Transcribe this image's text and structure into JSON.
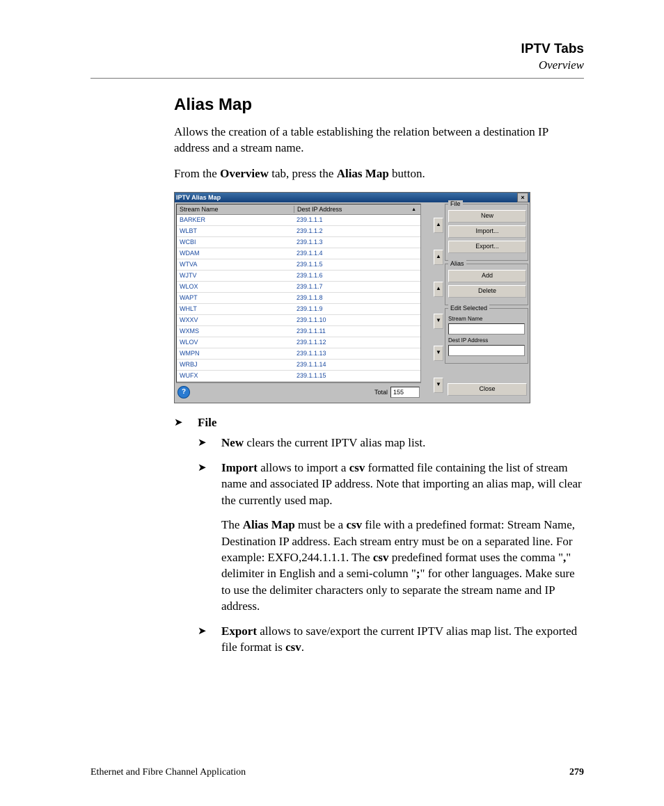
{
  "header": {
    "title": "IPTV Tabs",
    "subtitle": "Overview"
  },
  "section_title": "Alias Map",
  "intro1": "Allows the creation of a table establishing the relation between a destination IP address and a stream name.",
  "intro2_a": "From the ",
  "intro2_b": "Overview",
  "intro2_c": " tab, press the ",
  "intro2_d": "Alias Map",
  "intro2_e": " button.",
  "dialog": {
    "title": "IPTV Alias Map",
    "close_x": "×",
    "columns": {
      "stream": "Stream Name",
      "dest": "Dest IP Address"
    },
    "rows": [
      {
        "name": "BARKER",
        "ip": "239.1.1.1"
      },
      {
        "name": "WLBT",
        "ip": "239.1.1.2"
      },
      {
        "name": "WCBI",
        "ip": "239.1.1.3"
      },
      {
        "name": "WDAM",
        "ip": "239.1.1.4"
      },
      {
        "name": "WTVA",
        "ip": "239.1.1.5"
      },
      {
        "name": "WJTV",
        "ip": "239.1.1.6"
      },
      {
        "name": "WLOX",
        "ip": "239.1.1.7"
      },
      {
        "name": "WAPT",
        "ip": "239.1.1.8"
      },
      {
        "name": "WHLT",
        "ip": "239.1.1.9"
      },
      {
        "name": "WXXV",
        "ip": "239.1.1.10"
      },
      {
        "name": "WXMS",
        "ip": "239.1.1.11"
      },
      {
        "name": "WLOV",
        "ip": "239.1.1.12"
      },
      {
        "name": "WMPN",
        "ip": "239.1.1.13"
      },
      {
        "name": "WRBJ",
        "ip": "239.1.1.14"
      },
      {
        "name": "WUFX",
        "ip": "239.1.1.15"
      }
    ],
    "total_label": "Total",
    "total_value": "155",
    "help": "?",
    "groups": {
      "file": {
        "title": "File",
        "new": "New",
        "import": "Import...",
        "export": "Export..."
      },
      "alias": {
        "title": "Alias",
        "add": "Add",
        "delete": "Delete"
      },
      "edit": {
        "title": "Edit Selected",
        "stream_label": "Stream Name",
        "dest_label": "Dest IP Address"
      }
    },
    "close": "Close",
    "arrows": {
      "top": "▲",
      "up": "▲",
      "mid_up": "▲",
      "mid_dn": "▼",
      "dn": "▼",
      "bot": "▼"
    }
  },
  "list": {
    "file_label": "File",
    "new_label": "New",
    "new_text": " clears the current IPTV alias map list.",
    "import_label": "Import",
    "import_text_a": " allows to import a ",
    "csv": "csv",
    "import_text_b": " formatted file containing the list of stream name and associated IP address. Note that importing an alias map, will clear the currently used map.",
    "import_para2_a": "The ",
    "import_para2_b": "Alias Map",
    "import_para2_c": " must be a ",
    "import_para2_d": " file with a predefined format: Stream Name, Destination IP address. Each stream entry must be on a separated line. For example: EXFO,244.1.1.1. The ",
    "import_para2_e": " predefined format uses the comma \"",
    "comma": ",",
    "import_para2_f": "\" delimiter in English and a semi-column \"",
    "semi": ";",
    "import_para2_g": "\" for other languages. Make sure to use the delimiter characters only to separate the stream name and IP address.",
    "export_label": "Export",
    "export_text_a": " allows to save/export the current IPTV alias map list. The exported file format is ",
    "export_text_b": "."
  },
  "footer": {
    "left": "Ethernet and Fibre Channel Application",
    "page": "279"
  }
}
